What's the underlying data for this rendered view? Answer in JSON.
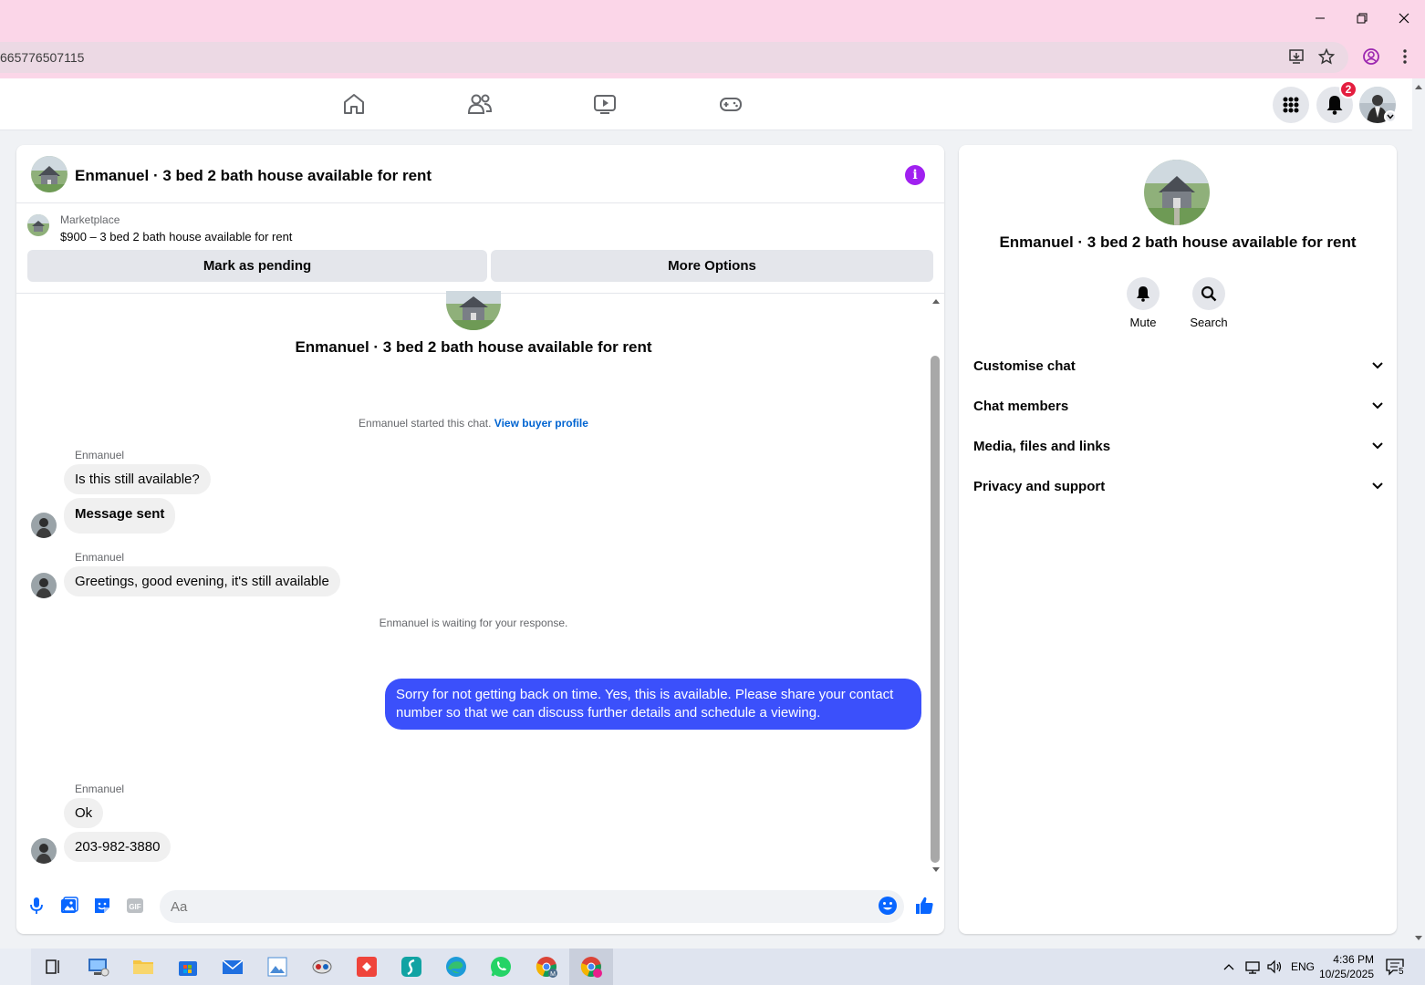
{
  "browser": {
    "url_fragment": "665776507115"
  },
  "fbnav": {
    "notification_count": "2"
  },
  "chat": {
    "header_title": "Enmanuel · 3 bed 2 bath house available for rent",
    "marketplace_label": "Marketplace",
    "listing_desc": "$900 – 3 bed 2 bath house available for rent",
    "mark_pending_label": "Mark as pending",
    "more_options_label": "More Options",
    "intro_title": "Enmanuel · 3 bed 2 bath house available for rent",
    "started_text": "Enmanuel started this chat. ",
    "view_buyer_profile": "View buyer profile",
    "waiting_text": "Enmanuel is waiting for your response.",
    "messages": [
      {
        "sender": "Enmanuel",
        "text": "Is this still available?"
      },
      {
        "text": "Message sent"
      },
      {
        "sender": "Enmanuel",
        "text": "Greetings, good evening, it's still available"
      },
      {
        "text": "Sorry for not getting back on time. Yes, this is available. Please share your contact number so that we can discuss further details and schedule a viewing."
      },
      {
        "sender": "Enmanuel",
        "text": "Ok"
      },
      {
        "text": "203-982-3880"
      }
    ],
    "composer_placeholder": "Aa"
  },
  "side": {
    "name": "Enmanuel · 3 bed 2 bath house available for rent",
    "mute_label": "Mute",
    "search_label": "Search",
    "sections": [
      "Customise chat",
      "Chat members",
      "Media, files and links",
      "Privacy and support"
    ]
  },
  "taskbar": {
    "language": "ENG",
    "time": "4:36 PM",
    "date": "10/25/2025",
    "notif_count": "5"
  },
  "colors": {
    "outgoing_bubble": "#3b50fb",
    "incoming_bubble": "#f0f0f0",
    "link": "#0064d1",
    "badge": "#e41e3f",
    "titlebar": "#fbd6e8"
  }
}
